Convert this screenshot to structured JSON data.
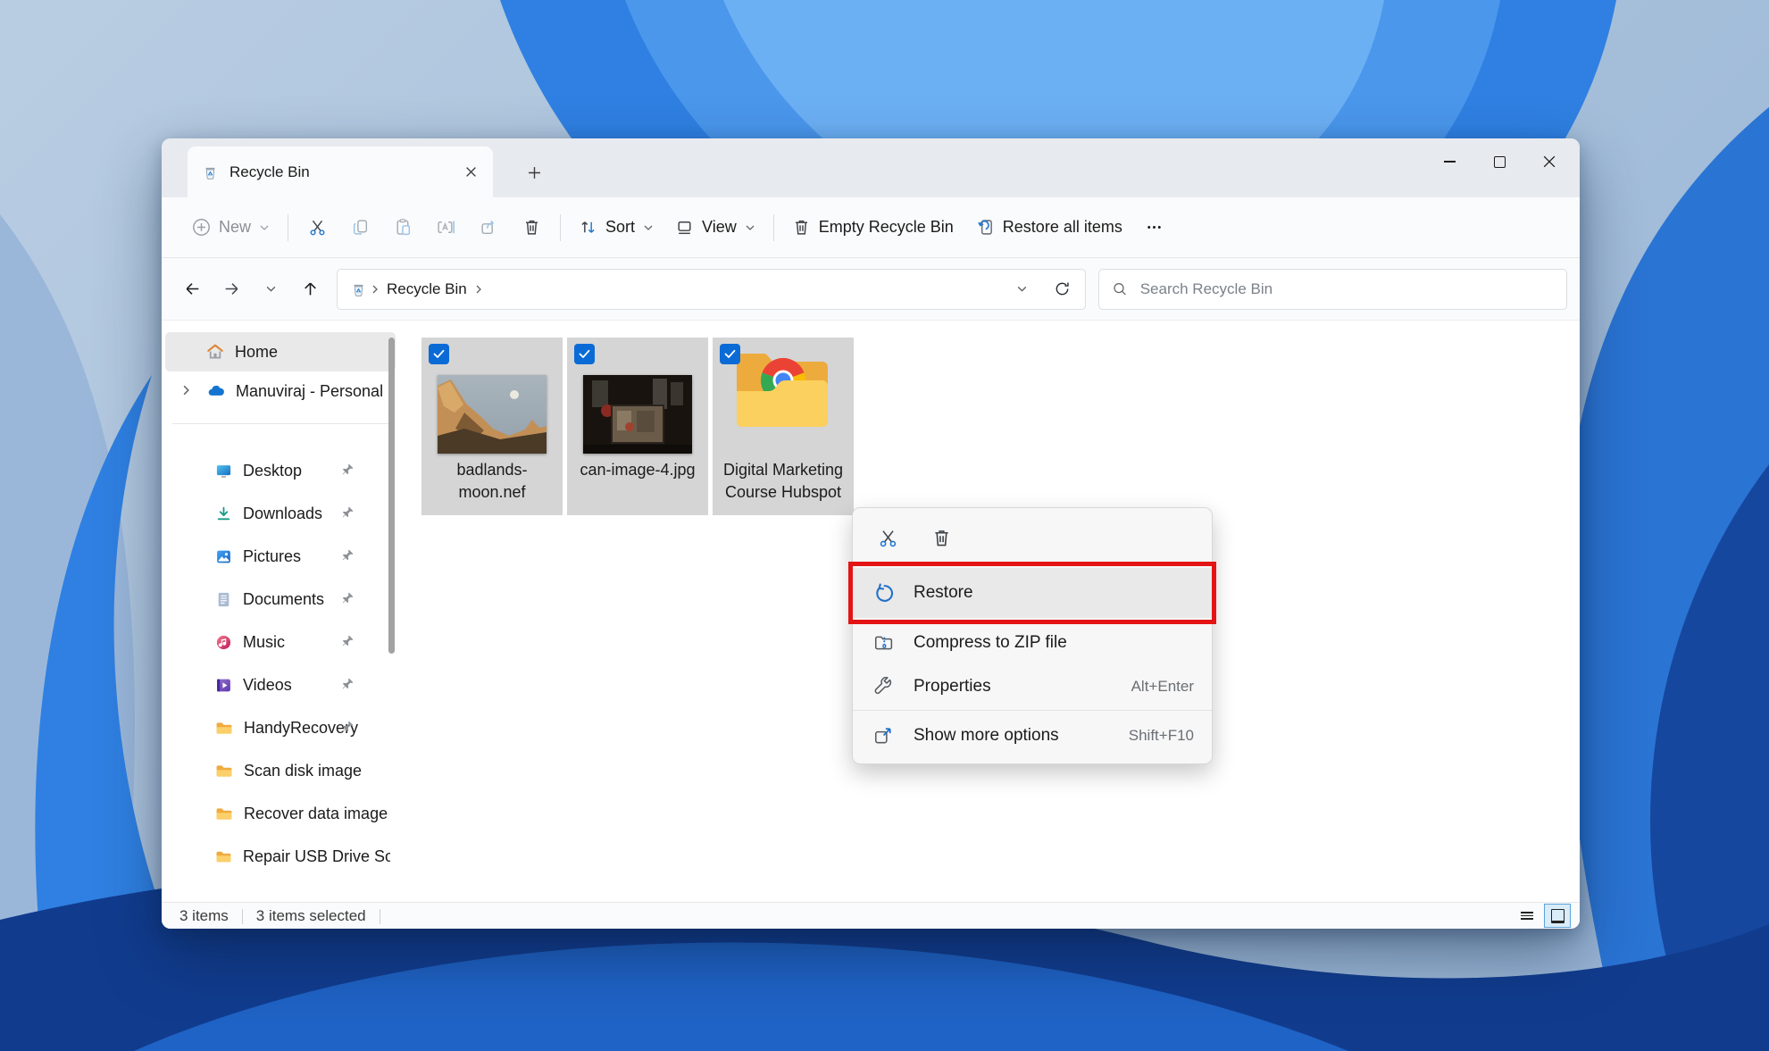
{
  "window": {
    "tab_title": "Recycle Bin",
    "toolbar": {
      "new": "New",
      "sort": "Sort",
      "view": "View",
      "empty_recycle_bin": "Empty Recycle Bin",
      "restore_all": "Restore all items"
    },
    "navbar": {
      "breadcrumb": "Recycle Bin",
      "search_placeholder": "Search Recycle Bin"
    },
    "sidebar": {
      "home": "Home",
      "onedrive": "Manuviraj - Personal",
      "items": [
        {
          "label": "Desktop",
          "icon": "desktop",
          "pinned": true
        },
        {
          "label": "Downloads",
          "icon": "downloads",
          "pinned": true
        },
        {
          "label": "Pictures",
          "icon": "pictures",
          "pinned": true
        },
        {
          "label": "Documents",
          "icon": "documents",
          "pinned": true
        },
        {
          "label": "Music",
          "icon": "music",
          "pinned": true
        },
        {
          "label": "Videos",
          "icon": "videos",
          "pinned": true
        },
        {
          "label": "HandyRecovery",
          "icon": "folder",
          "pinned": true
        },
        {
          "label": "Scan disk image",
          "icon": "folder",
          "pinned": false
        },
        {
          "label": "Recover data image",
          "icon": "folder",
          "pinned": false
        },
        {
          "label": "Repair USB Drive Sof",
          "icon": "folder",
          "pinned": false
        }
      ]
    },
    "files": [
      {
        "name": "badlands-moon.nef",
        "type": "image",
        "checked": true,
        "selected": true
      },
      {
        "name": "can-image-4.jpg",
        "type": "image",
        "checked": true,
        "selected": true
      },
      {
        "name": "Digital Marketing Course Hubspot",
        "type": "folder-chrome",
        "checked": true,
        "selected": true
      }
    ],
    "context_menu": {
      "restore": "Restore",
      "compress": "Compress to ZIP file",
      "properties": "Properties",
      "properties_shortcut": "Alt+Enter",
      "show_more": "Show more options",
      "show_more_shortcut": "Shift+F10"
    },
    "statusbar": {
      "count": "3 items",
      "selected": "3 items selected"
    }
  },
  "colors": {
    "accent_blue": "#0f6cbd",
    "annotation_red": "#e41414",
    "checkbox_blue": "#0b6bd6",
    "tile_selection_gray": "#d5d5d5",
    "wallpaper_bright_petal": "#2f80e2",
    "wallpaper_dark_petal": "#123f93"
  },
  "icons": {
    "tab": "recycle-bin-icon",
    "toolbar": [
      "plus-circle-icon",
      "cut-icon",
      "copy-icon",
      "paste-icon",
      "rename-icon",
      "share-icon",
      "delete-icon",
      "sort-icon",
      "view-icon",
      "empty-bin-icon",
      "restore-all-icon",
      "ellipsis-icon"
    ],
    "nav": [
      "back-arrow-icon",
      "forward-arrow-icon",
      "recent-chevron-icon",
      "up-arrow-icon",
      "refresh-icon",
      "search-icon"
    ],
    "context_menu": [
      "cut-icon",
      "delete-icon",
      "restore-icon",
      "compress-zip-icon",
      "wrench-icon",
      "show-more-icon"
    ]
  }
}
